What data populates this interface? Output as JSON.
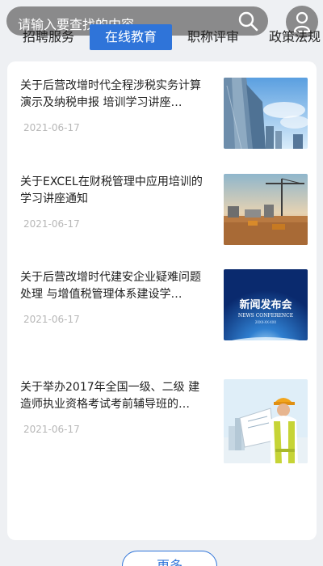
{
  "search": {
    "placeholder": "请输入要查找的内容"
  },
  "tabs": [
    {
      "label": "招聘服务",
      "active": false
    },
    {
      "label": "在线教育",
      "active": true
    },
    {
      "label": "职称评审",
      "active": false
    },
    {
      "label": "政策法规",
      "active": false
    }
  ],
  "articles": [
    {
      "title": "关于后营改增时代全程涉税实务计算演示及纳税申报 培训学习讲座…",
      "date": "2021-06-17",
      "image": "city-skyscrapers-image"
    },
    {
      "title": "关于EXCEL在财税管理中应用培训的学习讲座通知",
      "date": "2021-06-17",
      "image": "construction-site-image"
    },
    {
      "title": "关于后营改增时代建安企业疑难问题处理 与增值税管理体系建设学…",
      "date": "2021-06-17",
      "image": "news-conference-image",
      "image_text": {
        "cn": "新闻发布会",
        "en": "NEWS CONFERENCE",
        "sub": "20XX-XX-XXX"
      }
    },
    {
      "title": "关于举办2017年全国一级、二级 建造师执业资格考试考前辅导班的…",
      "date": "2021-06-17",
      "image": "engineer-image"
    }
  ],
  "more_label": "更多",
  "colors": {
    "accent": "#2f74d9",
    "date": "#b7b7b7"
  }
}
